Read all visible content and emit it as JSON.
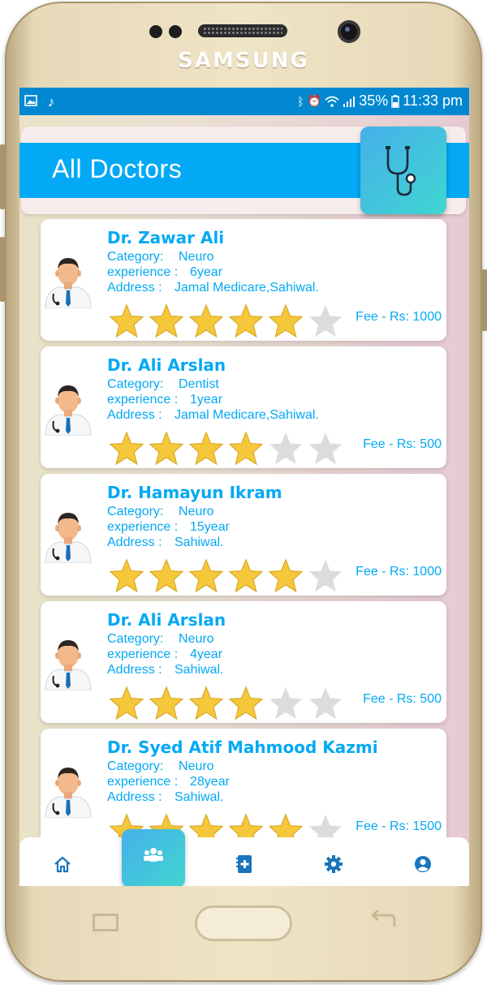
{
  "device": {
    "brand": "SAMSUNG"
  },
  "status_bar": {
    "left_icons": [
      "image-icon",
      "music-note-icon"
    ],
    "right_icons": [
      "bluetooth-icon",
      "alarm-icon",
      "wifi-icon",
      "signal-icon",
      "battery-icon"
    ],
    "battery": "35%",
    "time": "11:33 pm"
  },
  "header": {
    "title": "All Doctors",
    "icon": "stethoscope-icon"
  },
  "labels": {
    "category": "Category:",
    "experience": "experience :",
    "address": "Address :"
  },
  "doctors": [
    {
      "name": "Dr. Zawar Ali",
      "category": "Neuro",
      "experience": "6year",
      "address": "Jamal Medicare,Sahiwal.",
      "rating": 5,
      "fee": "Fee - Rs: 1000"
    },
    {
      "name": "Dr. Ali Arslan",
      "category": "Dentist",
      "experience": "1year",
      "address": "Jamal Medicare,Sahiwal.",
      "rating": 4,
      "fee": "Fee - Rs: 500"
    },
    {
      "name": "Dr. Hamayun Ikram",
      "category": "Neuro",
      "experience": "15year",
      "address": "Sahiwal.",
      "rating": 5,
      "fee": "Fee - Rs: 1000"
    },
    {
      "name": "Dr. Ali Arslan",
      "category": "Neuro",
      "experience": "4year",
      "address": "Sahiwal.",
      "rating": 4,
      "fee": "Fee - Rs: 500"
    },
    {
      "name": "Dr. Syed Atif Mahmood Kazmi",
      "category": "Neuro",
      "experience": "28year",
      "address": "Sahiwal.",
      "rating": 5,
      "fee": "Fee - Rs: 1500"
    }
  ],
  "star_max": 6,
  "colors": {
    "accent": "#03a9f4",
    "status_bar": "#0288d1",
    "star_on": "#f4c83a",
    "star_off": "#dcdcdc"
  },
  "bottom_nav": {
    "items": [
      "home-icon",
      "doctors-icon",
      "records-icon",
      "settings-icon",
      "profile-icon"
    ],
    "active": "doctors-icon"
  }
}
